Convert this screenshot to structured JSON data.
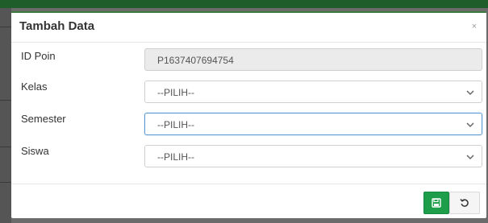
{
  "modal": {
    "title": "Tambah Data",
    "close_glyph": "×"
  },
  "form": {
    "id_poin": {
      "label": "ID Poin",
      "value": "P1637407694754"
    },
    "kelas": {
      "label": "Kelas",
      "value": "--PILIH--"
    },
    "semester": {
      "label": "Semester",
      "value": "--PILIH--"
    },
    "siswa": {
      "label": "Siswa",
      "value": "--PILIH--"
    }
  },
  "buttons": {
    "save": {
      "icon": "save-icon"
    },
    "reset": {
      "icon": "undo-icon"
    }
  },
  "colors": {
    "save_button": "#1e9e4a",
    "header_bar": "#1f5e2b",
    "focus_border": "#5b9bd5"
  }
}
